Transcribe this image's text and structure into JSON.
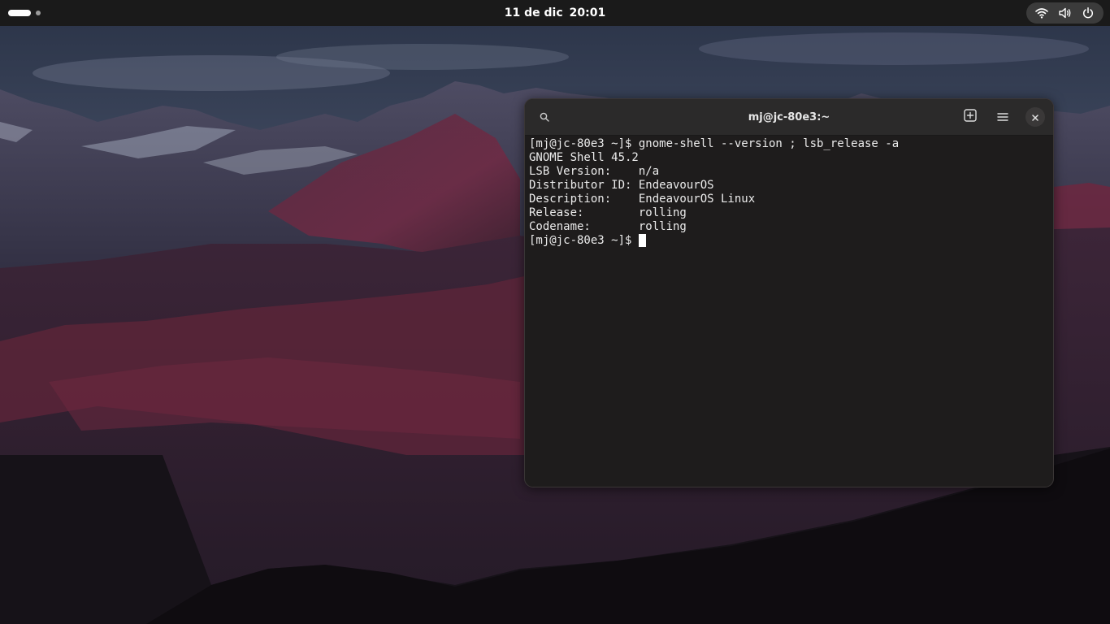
{
  "topbar": {
    "date": "11 de dic",
    "time": "20:01",
    "icons": [
      "wifi-icon",
      "volume-icon",
      "power-icon"
    ]
  },
  "terminal": {
    "title": "mj@jc-80e3:~",
    "lines": [
      "[mj@jc-80e3 ~]$ gnome-shell --version ; lsb_release -a",
      "GNOME Shell 45.2",
      "LSB Version:    n/a",
      "Distributor ID: EndeavourOS",
      "Description:    EndeavourOS Linux",
      "Release:        rolling",
      "Codename:       rolling"
    ],
    "prompt": "[mj@jc-80e3 ~]$",
    "header_icons": [
      "search-icon",
      "new-tab-icon",
      "menu-icon",
      "close-icon"
    ]
  },
  "colors": {
    "topbar": "#1a1a1a",
    "terminal_bg": "#1e1c1c",
    "headerbar": "#2b2a2a",
    "text": "#ececec"
  }
}
